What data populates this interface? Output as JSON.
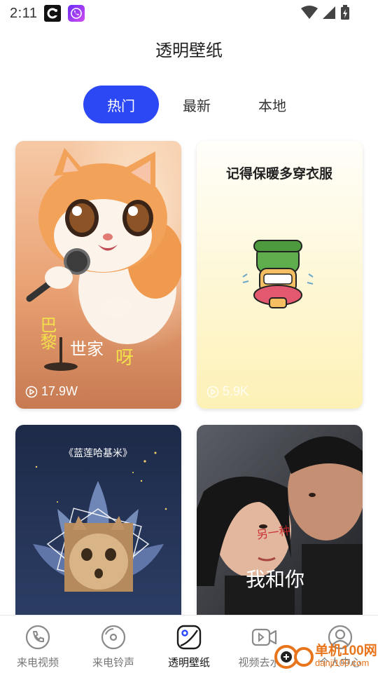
{
  "status_bar": {
    "time": "2:11",
    "apps": [
      "c-app-icon",
      "phone-app-icon"
    ],
    "icons": [
      "wifi-icon",
      "signal-icon",
      "battery-icon"
    ]
  },
  "header": {
    "title": "透明壁纸"
  },
  "tabs": [
    {
      "label": "热门",
      "active": true
    },
    {
      "label": "最新",
      "active": false
    },
    {
      "label": "本地",
      "active": false
    }
  ],
  "cards": [
    {
      "overlay_text_1": "巴黎",
      "overlay_text_2": "世家",
      "overlay_text_3": "呀",
      "views": "17.9W"
    },
    {
      "overlay_text_1": "记得保暖多穿衣服",
      "views": "5.9K"
    },
    {
      "overlay_text_1": "《蓝莲哈基米》"
    },
    {
      "overlay_text_1": "我和你"
    }
  ],
  "bottom_nav": [
    {
      "label": "来电视频",
      "icon": "phone-icon",
      "active": false
    },
    {
      "label": "来电铃声",
      "icon": "vinyl-icon",
      "active": false
    },
    {
      "label": "透明壁纸",
      "icon": "wallpaper-icon",
      "active": true
    },
    {
      "label": "视频去水印",
      "icon": "video-camera-icon",
      "active": false
    },
    {
      "label": "个人中心",
      "icon": "user-icon",
      "active": false
    }
  ],
  "watermark": {
    "line1": "单机100网",
    "line2": "danji100.com"
  },
  "colors": {
    "accent": "#2c48f4",
    "watermark": "#e8741c"
  }
}
